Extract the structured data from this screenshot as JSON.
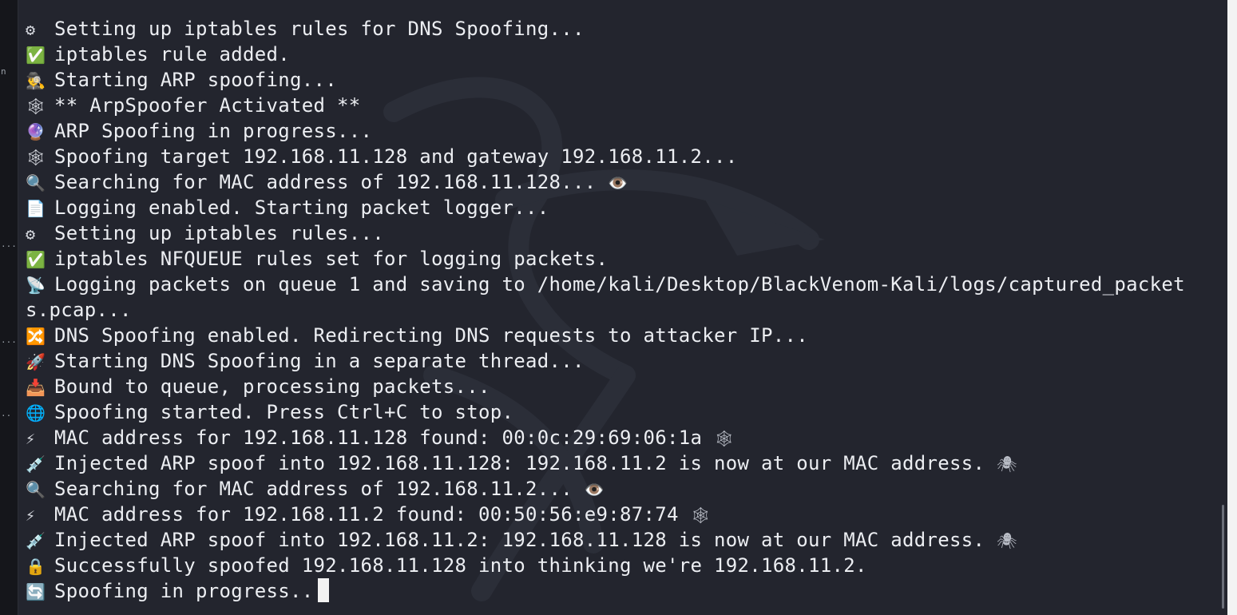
{
  "terminal": {
    "lines": [
      {
        "icon": "⚙",
        "text": "Setting up iptables rules for DNS Spoofing...",
        "tail": ""
      },
      {
        "icon": "✅",
        "text": "iptables rule added.",
        "tail": ""
      },
      {
        "icon": "🕵️‍♂️",
        "text": "Starting ARP spoofing...",
        "tail": ""
      },
      {
        "icon": "🕸",
        "text": "** ArpSpoofer Activated **",
        "tail": ""
      },
      {
        "icon": "🔮",
        "text": "ARP Spoofing in progress...",
        "tail": ""
      },
      {
        "icon": "🕸",
        "text": "Spoofing target 192.168.11.128 and gateway 192.168.11.2...",
        "tail": ""
      },
      {
        "icon": "🔍",
        "text": "Searching for MAC address of 192.168.11.128...",
        "tail": "👁️"
      },
      {
        "icon": "📄",
        "text": "Logging enabled. Starting packet logger...",
        "tail": ""
      },
      {
        "icon": "⚙",
        "text": "Setting up iptables rules...",
        "tail": ""
      },
      {
        "icon": "✅",
        "text": "iptables NFQUEUE rules set for logging packets.",
        "tail": ""
      },
      {
        "icon": "📡",
        "text": "Logging packets on queue 1 and saving to /home/kali/Desktop/BlackVenom-Kali/logs/captured_packet",
        "tail": ""
      },
      {
        "icon": "",
        "text": "s.pcap...",
        "tail": ""
      },
      {
        "icon": "🔀",
        "text": "DNS Spoofing enabled. Redirecting DNS requests to attacker IP...",
        "tail": ""
      },
      {
        "icon": "🚀",
        "text": "Starting DNS Spoofing in a separate thread...",
        "tail": ""
      },
      {
        "icon": "📥",
        "text": "Bound to queue, processing packets...",
        "tail": ""
      },
      {
        "icon": "🌐",
        "text": "Spoofing started. Press Ctrl+C to stop.",
        "tail": ""
      },
      {
        "icon": "⚡",
        "text": "MAC address for 192.168.11.128 found: 00:0c:29:69:06:1a",
        "tail": "🕸"
      },
      {
        "icon": "💉",
        "text": "Injected ARP spoof into 192.168.11.128: 192.168.11.2 is now at our MAC address.",
        "tail": "🕷"
      },
      {
        "icon": "🔍",
        "text": "Searching for MAC address of 192.168.11.2...",
        "tail": "👁️"
      },
      {
        "icon": "⚡",
        "text": "MAC address for 192.168.11.2 found: 00:50:56:e9:87:74",
        "tail": "🕸"
      },
      {
        "icon": "💉",
        "text": "Injected ARP spoof into 192.168.11.2: 192.168.11.128 is now at our MAC address.",
        "tail": "🕷"
      },
      {
        "icon": "🔒",
        "text": "Successfully spoofed 192.168.11.128 into thinking we're 192.168.11.2.",
        "tail": ""
      },
      {
        "icon": "🔄",
        "text": "Spoofing in progress..",
        "tail": ""
      }
    ]
  },
  "left_strip": {
    "fragments": [
      "n",
      "...",
      "...",
      ".."
    ]
  },
  "colors": {
    "terminal_bg": "#23252e",
    "text": "#eceef2",
    "cursor": "#f2f2f2"
  }
}
